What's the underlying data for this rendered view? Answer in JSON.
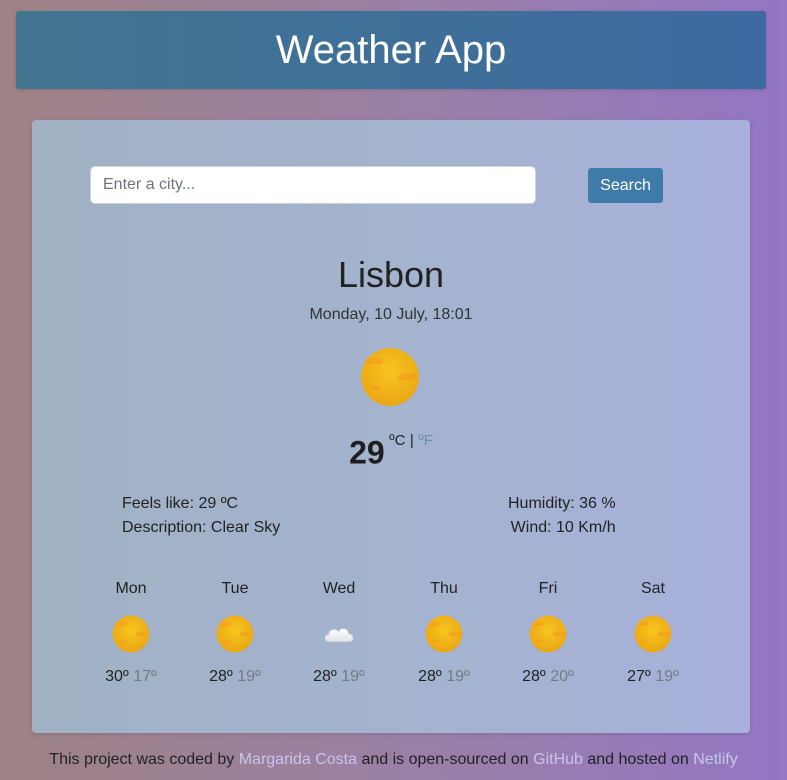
{
  "app": {
    "title": "Weather App"
  },
  "search": {
    "placeholder": "Enter a city...",
    "value": "",
    "button_label": "Search"
  },
  "current": {
    "city": "Lisbon",
    "datetime": "Monday, 10 July, 18:01",
    "icon": "sun-icon",
    "temperature": "29",
    "unit_celsius": "ºC",
    "unit_separator": "|",
    "unit_fahrenheit": "ºF",
    "feels_like": "Feels like: 29 ºC",
    "description": "Description: Clear Sky",
    "humidity": "Humidity: 36 %",
    "wind": "Wind: 10 Km/h"
  },
  "forecast": [
    {
      "day": "Mon",
      "icon": "sun-icon",
      "max": "30º",
      "min": "17º"
    },
    {
      "day": "Tue",
      "icon": "sun-icon",
      "max": "28º",
      "min": "19º"
    },
    {
      "day": "Wed",
      "icon": "cloud-icon",
      "max": "28º",
      "min": "19º"
    },
    {
      "day": "Thu",
      "icon": "sun-icon",
      "max": "28º",
      "min": "19º"
    },
    {
      "day": "Fri",
      "icon": "sun-icon",
      "max": "28º",
      "min": "20º"
    },
    {
      "day": "Sat",
      "icon": "sun-icon",
      "max": "27º",
      "min": "19º"
    }
  ],
  "footer": {
    "text1": "This project was coded by ",
    "author": "Margarida Costa",
    "text2": " and is open-sourced on ",
    "github": "GitHub",
    "text3": " and hosted on ",
    "netlify": "Netlify"
  },
  "colors": {
    "header": "#3d6aa0",
    "button": "#3f7ba8",
    "link": "#c7c5ec",
    "sun": "#f2b318",
    "min_temp": "#757a82",
    "fahrenheit": "#6a8db0"
  }
}
